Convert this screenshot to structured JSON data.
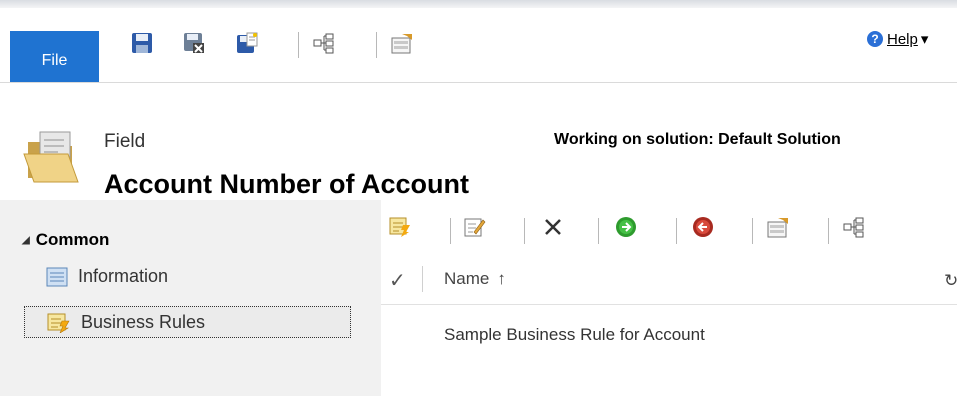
{
  "ribbon": {
    "file_label": "File",
    "help_label": "Help",
    "help_caret": "▾"
  },
  "header": {
    "entity_type": "Field",
    "entity_title": "Account Number of Account",
    "solution_text": "Working on solution: Default Solution"
  },
  "nav": {
    "group_label": "Common",
    "group_toggle": "◢",
    "items": [
      {
        "label": "Information",
        "icon": "form-icon"
      },
      {
        "label": "Business Rules",
        "icon": "business-rule-icon"
      }
    ]
  },
  "grid": {
    "column_name": "Name",
    "sort_indicator": "↑",
    "check_glyph": "✓",
    "refresh_glyph": "↻",
    "rows": [
      {
        "name": "Sample Business Rule for Account"
      }
    ]
  },
  "colors": {
    "file_tab": "#1f73d1",
    "left_pane": "#f1f1f1",
    "activate_green": "#2e9b2e",
    "deactivate_red": "#c0392b"
  }
}
